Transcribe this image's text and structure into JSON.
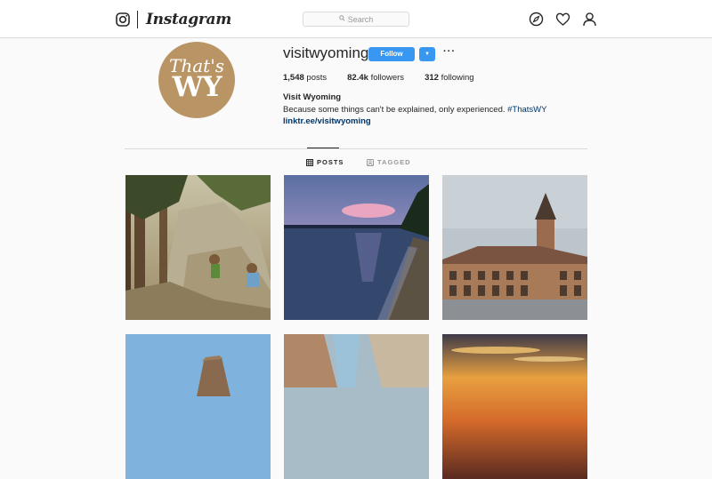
{
  "app": {
    "wordmark": "Instagram",
    "search_placeholder": "Search"
  },
  "nav": {
    "icons": [
      "instagram-glyph-icon",
      "compass-icon",
      "heart-icon",
      "person-icon"
    ]
  },
  "profile": {
    "avatar_line1": "That's",
    "avatar_line2": "WY",
    "username": "visitwyoming",
    "follow_label": "Follow",
    "stats": {
      "posts_count": "1,548",
      "posts_label": "posts",
      "followers_count": "82.4k",
      "followers_label": "followers",
      "following_count": "312",
      "following_label": "following"
    },
    "bio_name": "Visit Wyoming",
    "bio_text": "Because some things can't be explained, only experienced. ",
    "bio_hashtag": "#ThatsWY",
    "bio_link": "linktr.ee/visitwyoming"
  },
  "tabs": {
    "posts": "POSTS",
    "tagged": "TAGGED"
  },
  "colors": {
    "accent": "#3897f0",
    "avatar_bg": "#b99565",
    "link": "#003569"
  }
}
